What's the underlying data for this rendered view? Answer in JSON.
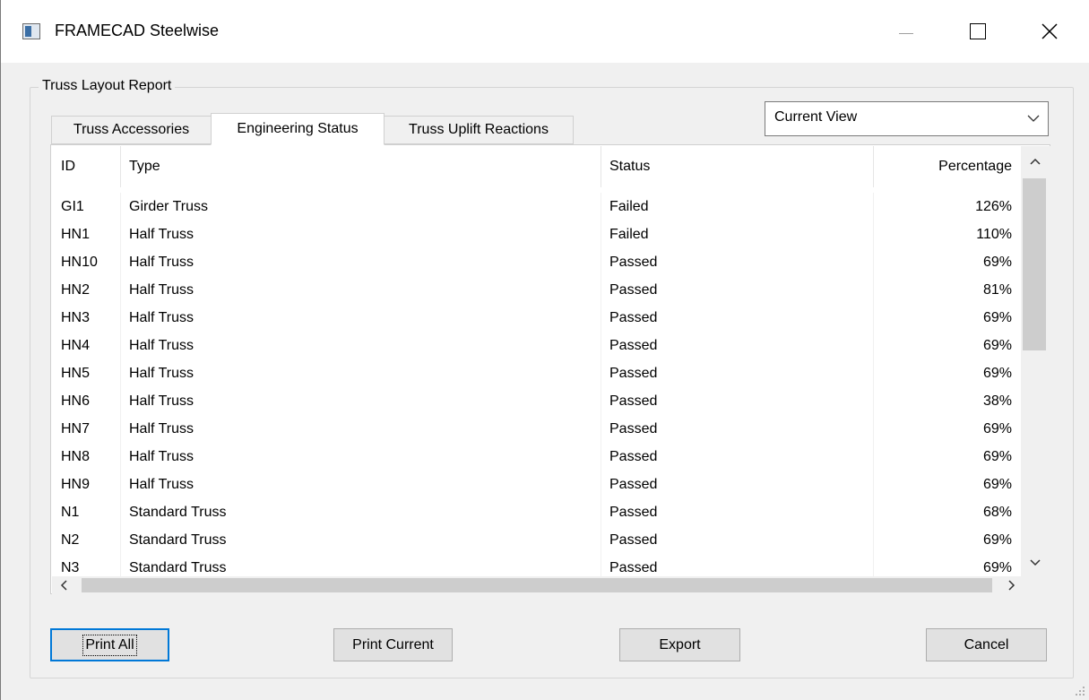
{
  "window": {
    "title": "FRAMECAD Steelwise"
  },
  "group": {
    "label": "Truss Layout Report"
  },
  "tabs": [
    {
      "label": "Truss Accessories",
      "active": false
    },
    {
      "label": "Engineering Status",
      "active": true
    },
    {
      "label": "Truss Uplift Reactions",
      "active": false
    }
  ],
  "view_select": {
    "value": "Current View"
  },
  "table": {
    "columns": {
      "id": "ID",
      "type": "Type",
      "status": "Status",
      "percentage": "Percentage"
    },
    "rows": [
      {
        "id": "GI1",
        "type": "Girder Truss",
        "status": "Failed",
        "percentage": "126%"
      },
      {
        "id": "HN1",
        "type": "Half Truss",
        "status": "Failed",
        "percentage": "110%"
      },
      {
        "id": "HN10",
        "type": "Half Truss",
        "status": "Passed",
        "percentage": "69%"
      },
      {
        "id": "HN2",
        "type": "Half Truss",
        "status": "Passed",
        "percentage": "81%"
      },
      {
        "id": "HN3",
        "type": "Half Truss",
        "status": "Passed",
        "percentage": "69%"
      },
      {
        "id": "HN4",
        "type": "Half Truss",
        "status": "Passed",
        "percentage": "69%"
      },
      {
        "id": "HN5",
        "type": "Half Truss",
        "status": "Passed",
        "percentage": "69%"
      },
      {
        "id": "HN6",
        "type": "Half Truss",
        "status": "Passed",
        "percentage": "38%"
      },
      {
        "id": "HN7",
        "type": "Half Truss",
        "status": "Passed",
        "percentage": "69%"
      },
      {
        "id": "HN8",
        "type": "Half Truss",
        "status": "Passed",
        "percentage": "69%"
      },
      {
        "id": "HN9",
        "type": "Half Truss",
        "status": "Passed",
        "percentage": "69%"
      },
      {
        "id": "N1",
        "type": "Standard Truss",
        "status": "Passed",
        "percentage": "68%"
      },
      {
        "id": "N2",
        "type": "Standard Truss",
        "status": "Passed",
        "percentage": "69%"
      },
      {
        "id": "N3",
        "type": "Standard Truss",
        "status": "Passed",
        "percentage": "69%"
      }
    ]
  },
  "buttons": {
    "print_all": "Print All",
    "print_current": "Print Current",
    "export": "Export",
    "cancel": "Cancel"
  },
  "colors": {
    "window_bg": "#f0f0f0",
    "list_bg": "#ffffff",
    "button_bg": "#e1e1e1",
    "focus_border": "#0078d7",
    "scroll_thumb": "#cdcdcd"
  }
}
